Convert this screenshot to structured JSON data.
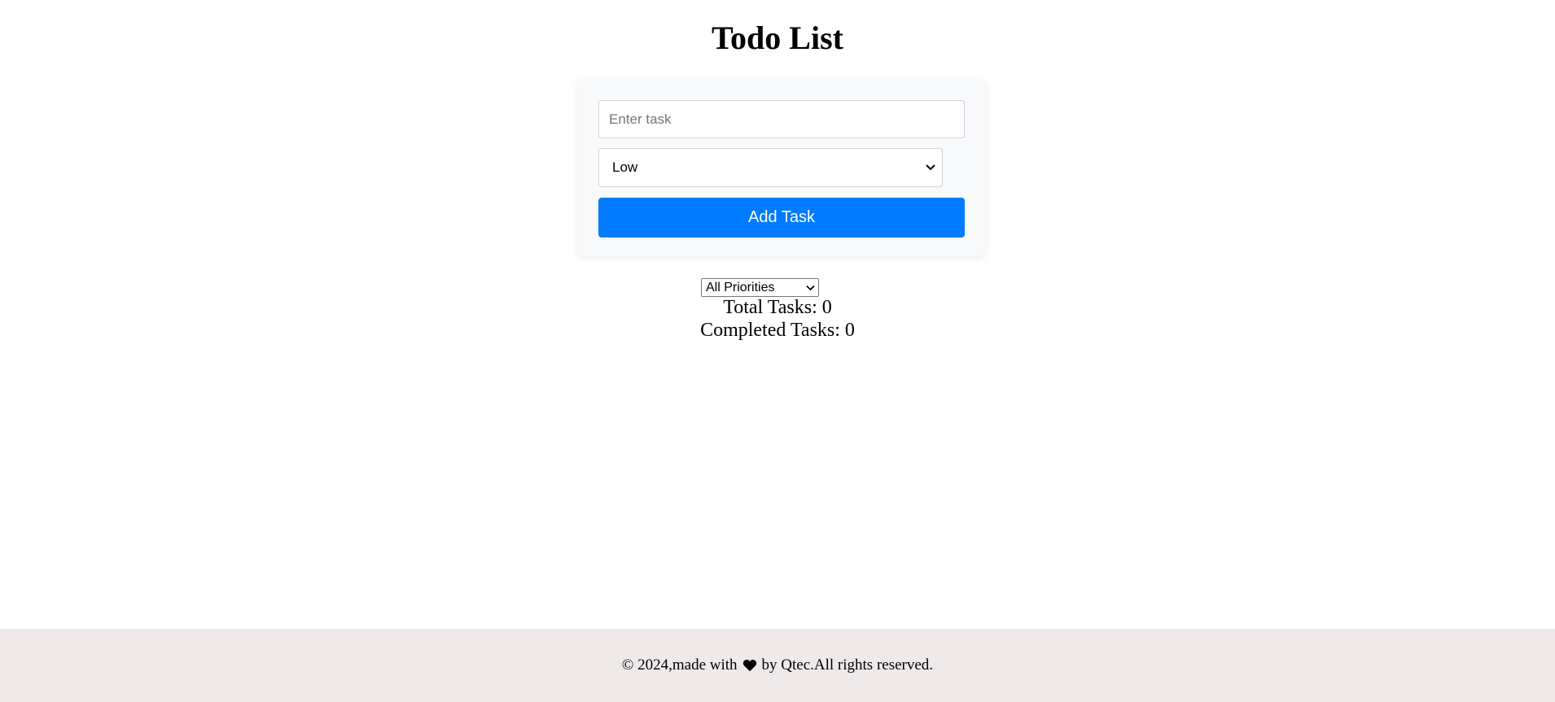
{
  "header": {
    "title": "Todo List"
  },
  "form": {
    "task_placeholder": "Enter task",
    "task_value": "",
    "priority_selected": "Low",
    "add_button_label": "Add Task",
    "accent_color": "#007bff"
  },
  "filter": {
    "selected": "All Priorities"
  },
  "stats": {
    "total_label": "Total Tasks: 0",
    "completed_label": "Completed Tasks: 0"
  },
  "footer": {
    "prefix": "© 2024,made with",
    "heart_icon": "heart-icon",
    "suffix": "by Qtec.All rights reserved."
  }
}
